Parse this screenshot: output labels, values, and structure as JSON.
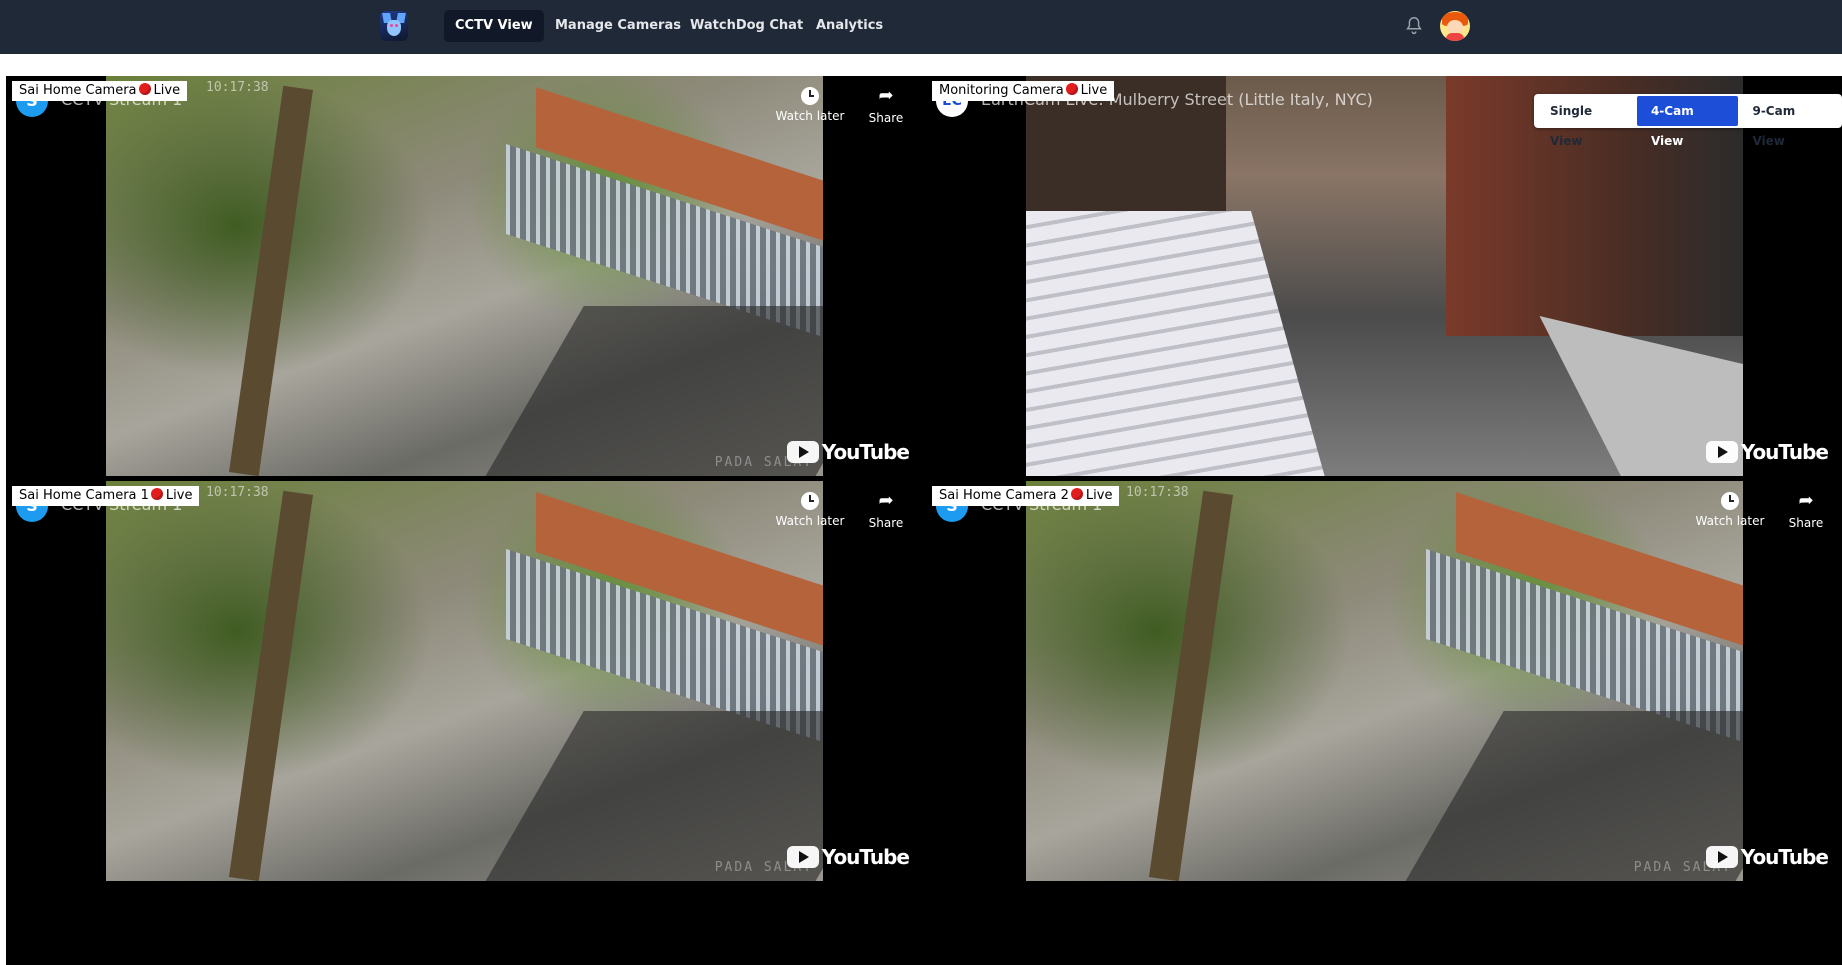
{
  "nav": {
    "links": [
      {
        "label": "CCTV View",
        "active": true
      },
      {
        "label": "Manage Cameras",
        "active": false
      },
      {
        "label": "WatchDog Chat",
        "active": false
      },
      {
        "label": "Analytics",
        "active": false
      }
    ],
    "icons": {
      "logo": "husky-logo-icon",
      "bell": "bell-icon",
      "avatar": "user-avatar"
    }
  },
  "view_toggle": {
    "options": [
      "Single View",
      "4-Cam View",
      "9-Cam View"
    ],
    "selected": "4-Cam View"
  },
  "cameras": [
    {
      "label": "Sai Home Camera",
      "status": "Live",
      "yt_channel_initial": "S",
      "yt_title": "CCTV Stream 1",
      "timestamp": "10:17:38",
      "watermark": "PADA SALAT"
    },
    {
      "label": "Monitoring Camera",
      "status": "Live",
      "yt_channel_initial": "EC",
      "yt_title": "EarthCam Live: Mulberry Street (Little Italy, NYC)",
      "timestamp": "",
      "watermark": ""
    },
    {
      "label": "Sai Home Camera 1",
      "status": "Live",
      "yt_channel_initial": "S",
      "yt_title": "CCTV Stream 1",
      "timestamp": "10:17:38",
      "watermark": "PADA SALAT"
    },
    {
      "label": "Sai Home Camera 2",
      "status": "Live",
      "yt_channel_initial": "S",
      "yt_title": "CCTV Stream 1",
      "timestamp": "10:17:38",
      "watermark": "PADA SALAT"
    }
  ],
  "yt_overlay": {
    "watch_later": "Watch later",
    "share": "Share",
    "logo": "YouTube"
  },
  "colors": {
    "navbar": "#1f2937",
    "active_toggle": "#1d4ed8",
    "live_dot": "#e11d1d"
  }
}
